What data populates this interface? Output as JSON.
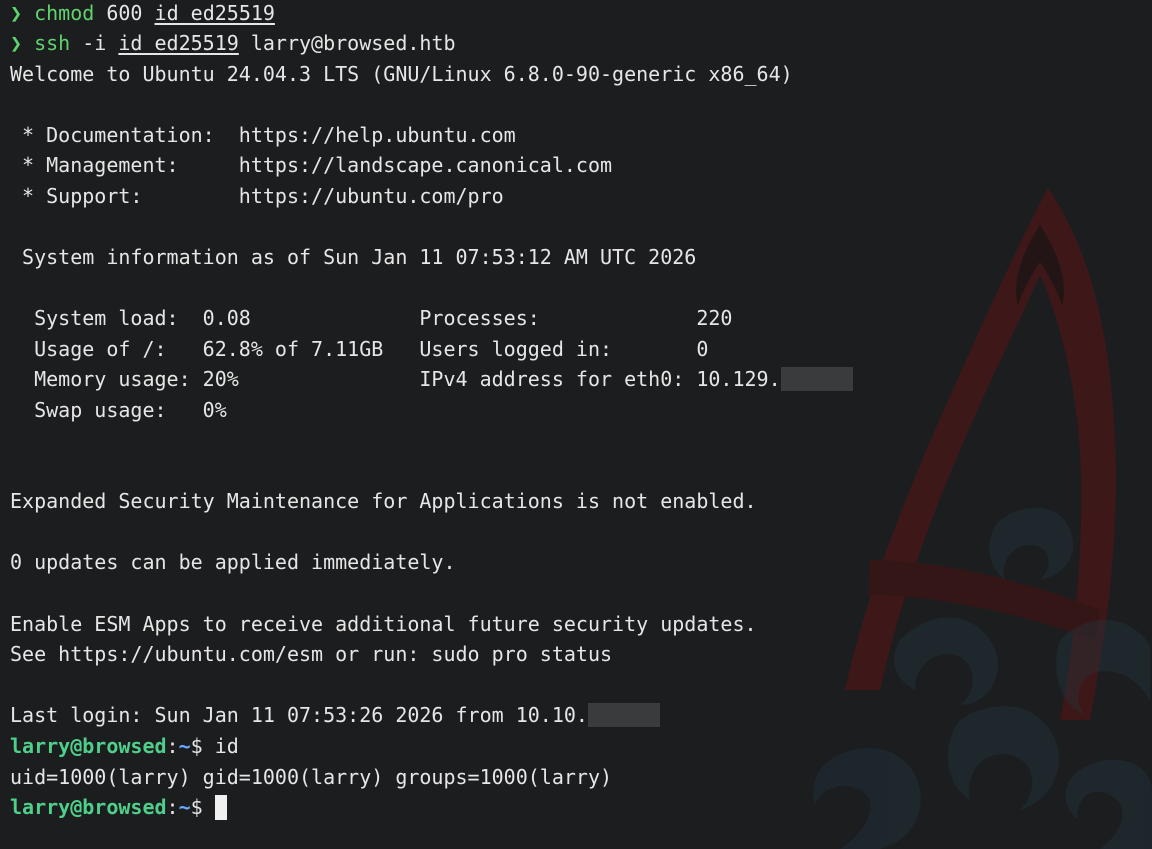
{
  "terminal": {
    "cmd1": {
      "symbol": "❯",
      "prog": "chmod",
      "arg1": " 600 ",
      "file": "id_ed25519"
    },
    "cmd2": {
      "symbol": "❯",
      "prog": "ssh",
      "arg1": " -i ",
      "file": "id_ed25519",
      "target": " larry@browsed.htb"
    },
    "welcome": "Welcome to Ubuntu 24.04.3 LTS (GNU/Linux 6.8.0-90-generic x86_64)",
    "doc": " * Documentation:  https://help.ubuntu.com",
    "mgmt": " * Management:     https://landscape.canonical.com",
    "support": " * Support:        https://ubuntu.com/pro",
    "sysinfo": " System information as of Sun Jan 11 07:53:12 AM UTC 2026",
    "stats": {
      "row1": "  System load:  0.08              Processes:             220",
      "row2": "  Usage of /:   62.8% of 7.11GB   Users logged in:       0",
      "row3": "  Memory usage: 20%               IPv4 address for eth0: 10.129.",
      "row4": "  Swap usage:   0%"
    },
    "esm": "Expanded Security Maintenance for Applications is not enabled.",
    "updates": "0 updates can be applied immediately.",
    "enable": "Enable ESM Apps to receive additional future security updates.",
    "see": "See https://ubuntu.com/esm or run: sudo pro status",
    "lastlogin": "Last login: Sun Jan 11 07:53:26 2026 from 10.10.",
    "prompt1": {
      "user": "larry@browsed",
      "colon": ":",
      "path": "~",
      "dollar": "$ ",
      "cmd": "id"
    },
    "uid": "uid=1000(larry) gid=1000(larry) groups=1000(larry)",
    "prompt2": {
      "user": "larry@browsed",
      "colon": ":",
      "path": "~",
      "dollar": "$ "
    }
  },
  "colors": {
    "background": "#1c1d1f",
    "text": "#e6e6e6",
    "command_green": "#5fd36d",
    "prompt_user": "#4fd08a",
    "prompt_path": "#6aa9ff",
    "emblem_red": "#5a1616"
  },
  "icons": {
    "background": "red-emblem-watermark"
  }
}
